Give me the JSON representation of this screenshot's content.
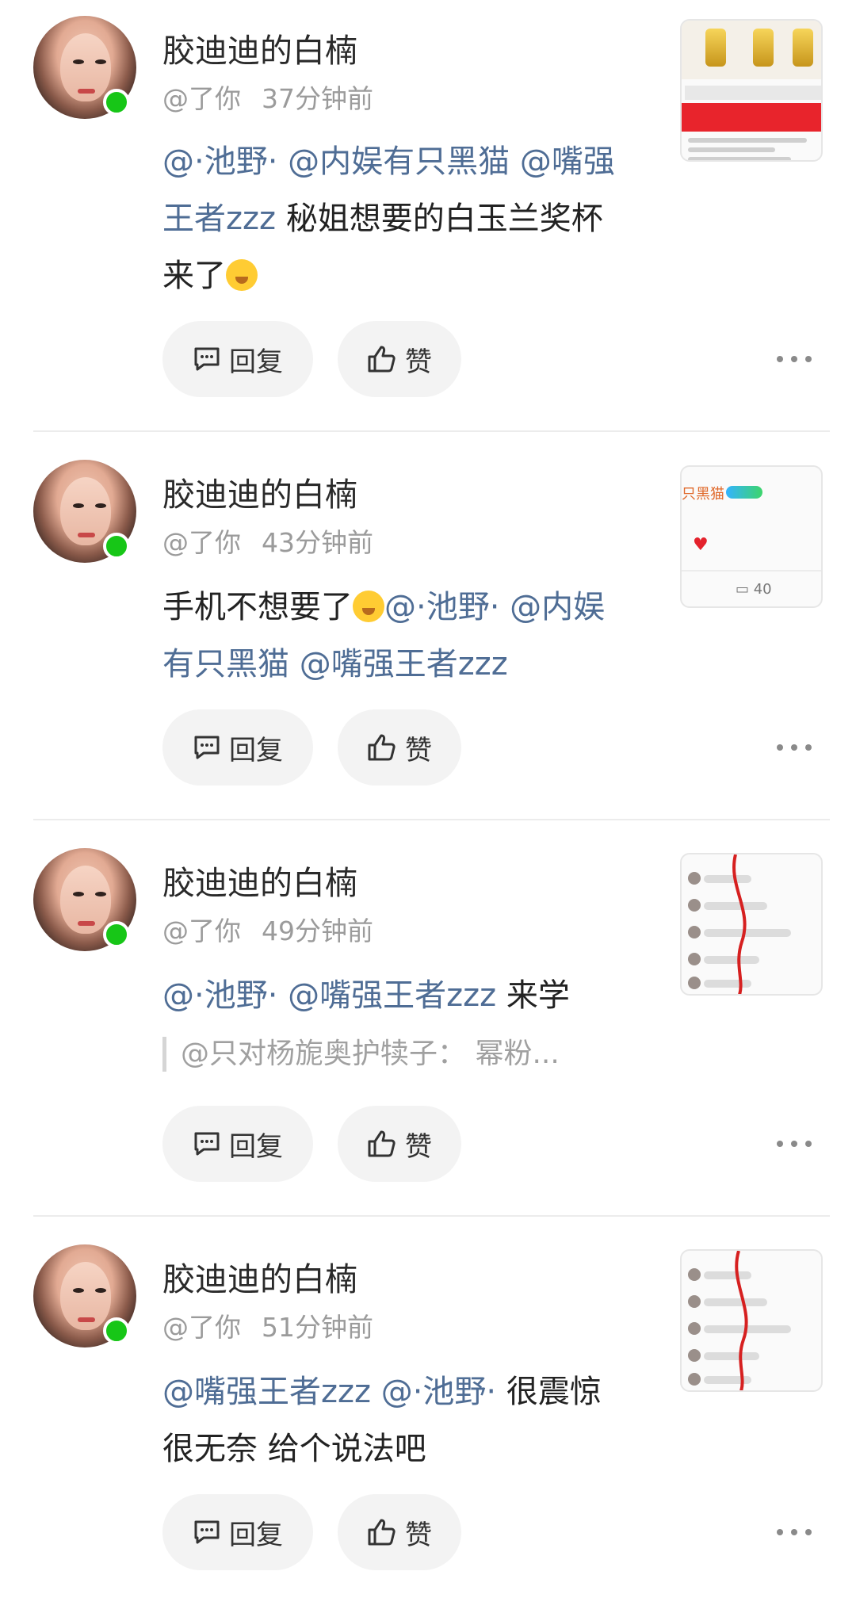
{
  "labels": {
    "reply": "回复",
    "like": "赞"
  },
  "items": [
    {
      "name": "胶迪迪的白楠",
      "mention_you": "@了你",
      "time": "37分钟前",
      "text": {
        "m1": "@·池野·",
        "m2": "@内娱有只黑猫",
        "m3": "@嘴强王者zzz",
        "t1": "秘姐想要的白玉兰奖杯来了"
      },
      "thumbnail": "gift-product-screenshot"
    },
    {
      "name": "胶迪迪的白楠",
      "mention_you": "@了你",
      "time": "43分钟前",
      "text": {
        "t0": "手机不想要了",
        "m1": "@·池野·",
        "m2": "@内娱有只黑猫",
        "m3": "@嘴强王者zzz"
      },
      "thumbnail": {
        "fragment": "只黑猫",
        "count": "40"
      }
    },
    {
      "name": "胶迪迪的白楠",
      "mention_you": "@了你",
      "time": "49分钟前",
      "text": {
        "m1": "@·池野·",
        "m2": "@嘴强王者zzz",
        "t1": "来学"
      },
      "quote": "@只对杨旎奥护犊子：  幂粉...",
      "thumbnail": "chat-screenshot"
    },
    {
      "name": "胶迪迪的白楠",
      "mention_you": "@了你",
      "time": "51分钟前",
      "text": {
        "m1": "@嘴强王者zzz",
        "m2": "@·池野·",
        "t1": "很震惊",
        "t2": "很无奈  给个说法吧"
      },
      "thumbnail": "chat-screenshot"
    }
  ],
  "colors": {
    "mention": "#4f6d95",
    "online": "#17c617",
    "button_bg": "#f3f3f3"
  }
}
